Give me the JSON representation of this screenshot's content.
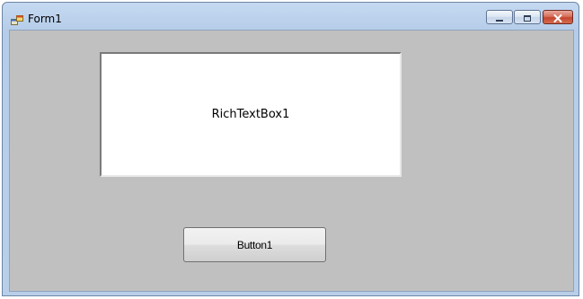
{
  "window": {
    "title": "Form1",
    "icon": "form-app-icon",
    "controls": {
      "minimize_icon": "minimize-icon",
      "maximize_icon": "maximize-icon",
      "close_icon": "close-icon"
    }
  },
  "form": {
    "richtextbox_text": "RichTextBox1",
    "button_label": "Button1"
  },
  "colors": {
    "client_background": "#c0c0c0",
    "titlebar": "#c5d9f1",
    "close_button": "#c4462f"
  }
}
